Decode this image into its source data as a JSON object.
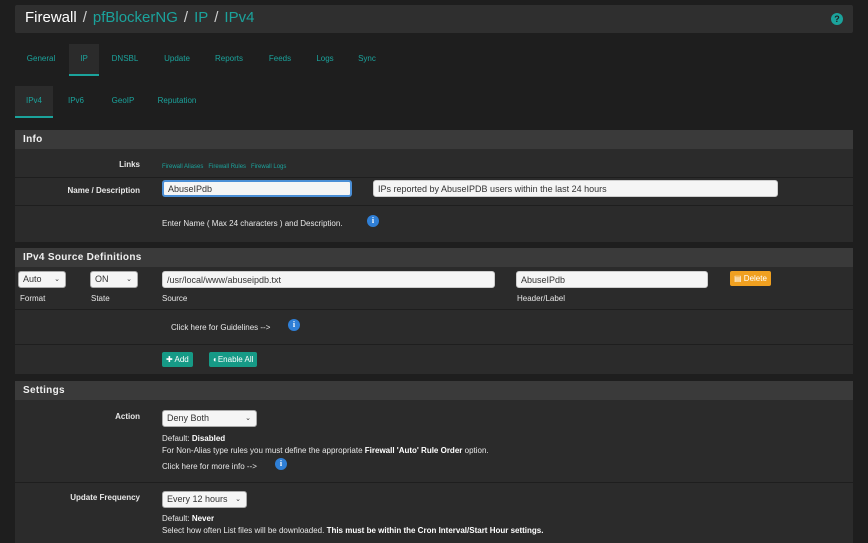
{
  "breadcrumb": {
    "root": "Firewall",
    "sep": "/",
    "items": [
      "pfBlockerNG",
      "IP",
      "IPv4"
    ]
  },
  "help_icon": "question-circle-icon",
  "main_tabs": [
    "General",
    "IP",
    "DNSBL",
    "Update",
    "Reports",
    "Feeds",
    "Logs",
    "Sync"
  ],
  "sub_tabs": [
    "IPv4",
    "IPv6",
    "GeoIP",
    "Reputation"
  ],
  "info": {
    "title": "Info",
    "links_label": "Links",
    "links": [
      "Firewall Aliases",
      "Firewall Rules",
      "Firewall Logs"
    ],
    "name_label": "Name / Description",
    "name_value": "AbuseIPdb",
    "desc_value": "IPs reported by AbuseIPDB users within the last 24 hours",
    "hint": "Enter Name ( Max 24 characters ) and Description."
  },
  "source": {
    "title": "IPv4 Source Definitions",
    "format_value": "Auto",
    "state_value": "ON",
    "source_value": "/usr/local/www/abuseipdb.txt",
    "header_value": "AbuseIPdb",
    "delete_label": "Delete",
    "col_format": "Format",
    "col_state": "State",
    "col_source": "Source",
    "col_header": "Header/Label",
    "guidelines": "Click here for Guidelines -->",
    "add_label": "Add",
    "enable_all_label": "Enable All"
  },
  "settings": {
    "title": "Settings",
    "action_label": "Action",
    "action_value": "Deny Both",
    "default_prefix": "Default:",
    "action_default": "Disabled",
    "action_note_1": "For Non-Alias type rules you must define the appropriate",
    "action_note_bold": "Firewall 'Auto' Rule Order",
    "action_note_2": "option.",
    "more_info": "Click here for more info -->",
    "freq_label": "Update Frequency",
    "freq_value": "Every 12 hours",
    "freq_default": "Never",
    "freq_note_1": "Select how often List files will be downloaded.",
    "freq_note_bold": "This must be within the Cron Interval/Start Hour settings."
  },
  "colors": {
    "accent": "#1ba39c",
    "info": "#2f7fd6",
    "warning": "#f0a020"
  }
}
